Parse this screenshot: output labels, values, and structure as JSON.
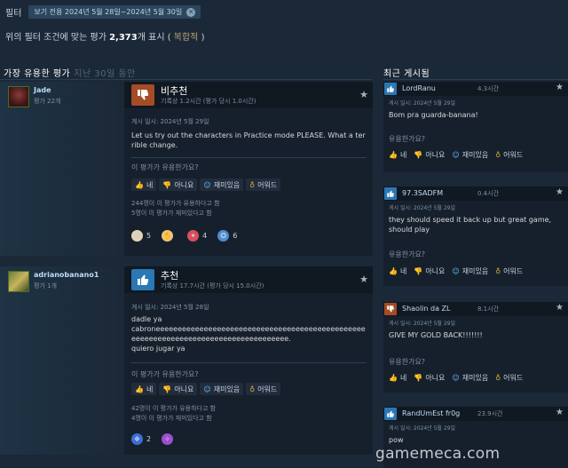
{
  "filter": {
    "label": "필터",
    "chip": "보기 전용 2024년 5월 28일~2024년 5월 30일",
    "chip_close": "✕"
  },
  "summary": {
    "prefix": "위의 필터 조건에 맞는 평가 ",
    "count": "2,373",
    "suffix": "개 표시 ( ",
    "rating": "복합적",
    "end": " )"
  },
  "sections": {
    "most_helpful": "가장 유용한 평가",
    "period": "지난 30일 동안",
    "recent": "최근 게시됨"
  },
  "reviews": [
    {
      "author": "Jade",
      "reviews_count": "평가 22개",
      "verdict": "비추천",
      "hours": "기록상 1.2시간 (평가 당시 1.0시간)",
      "posted": "게시 일시: 2024년 5월 29일",
      "content": "Let us try out the characters in Practice mode PLEASE. What a terrible change.",
      "helpful_q": "이 평가가 유용한가요?",
      "buttons": {
        "yes": "네",
        "no": "아니요",
        "funny": "재미있음",
        "award": "어워드"
      },
      "stats": "244명이 이 평가가 유용하다고 함\n5명이 이 평가가 재미있다고 함",
      "awards": [
        "5",
        "",
        "4",
        "6"
      ]
    },
    {
      "author": "adrianobanano1",
      "reviews_count": "평가 1개",
      "verdict": "추천",
      "hours": "기록상 17.7시간 (평가 당시 15.0시간)",
      "posted": "게시 일시: 2024년 5월 28일",
      "content": "dadle ya\ncabroneeeeeeeeeeeeeeeeeeeeeeeeeeeeeeeeeeeeeeeeeeeeeeeeeeeeeeeeeeeeeeeeeeeeeeeeeeeeeeeeeeee.\nquiero jugar ya",
      "helpful_q": "이 평가가 유용한가요?",
      "buttons": {
        "yes": "네",
        "no": "아니요",
        "funny": "재미있음",
        "award": "어워드"
      },
      "stats": "42명이 이 평가가 유용하다고 함\n4명이 이 평가가 재미있다고 함",
      "awards": [
        "2",
        ""
      ]
    }
  ],
  "recent": [
    {
      "author": "LordRanu",
      "hours": "4.3시간",
      "posted": "게시 일시: 2024년 5월 29일",
      "content": "Bom pra guarda-banana!",
      "vote": "up"
    },
    {
      "author": "97.3SADFM",
      "hours": "0.4시간",
      "posted": "게시 일시: 2024년 5월 29일",
      "content": "they should speed it back up but great game, should play",
      "vote": "up"
    },
    {
      "author": "Shaolin da ZL",
      "hours": "8.1시간",
      "posted": "게시 일시: 2024년 5월 29일",
      "content": "GIVE MY GOLD BACK!!!!!!!",
      "vote": "down"
    },
    {
      "author": "RandUmEst fr0g",
      "hours": "23.9시간",
      "posted": "게시 일시: 2024년 5월 29일",
      "content": "pow",
      "vote": "up"
    }
  ],
  "recent_labels": {
    "q": "유용한가요?",
    "yes": "네",
    "no": "아니요",
    "funny": "재미있음",
    "award": "어워드"
  },
  "watermark": "gamemeca.com",
  "colors": {
    "background": "#1b2838",
    "down_vote": "#a34c25",
    "up_vote": "#2a78b5",
    "link_blue": "#66c0f4",
    "mixed": "#b9a074"
  }
}
